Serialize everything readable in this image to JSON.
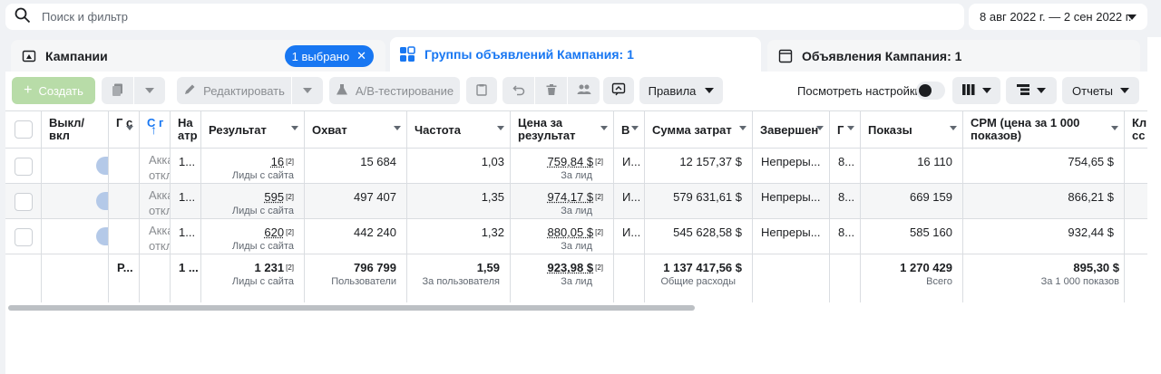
{
  "search": {
    "placeholder": "Поиск и фильтр",
    "icon": "search-icon"
  },
  "date_range": {
    "label": "8 авг 2022 г. — 2 сен 2022 г."
  },
  "tabs": {
    "campaigns": {
      "label": "Кампании",
      "selected": "1 выбрано"
    },
    "adsets": {
      "label": "Группы объявлений Кампания: 1"
    },
    "ads": {
      "label": "Объявления Кампания: 1"
    }
  },
  "toolbar": {
    "create": "Создать",
    "edit": "Редактировать",
    "ab_test": "A/B-тестирование",
    "rules": "Правила",
    "view_settings": "Посмотреть настройки",
    "reports": "Отчеты"
  },
  "columns": {
    "onoff": "Выкл/ вкл",
    "c1": "Г с",
    "c2": "С г",
    "c3": "На атр",
    "result": "Результат",
    "reach": "Охват",
    "frequency": "Частота",
    "cost_per_result": "Цена за результат",
    "c9": "В",
    "amount_spent": "Сумма затрат",
    "ends": "Завершен",
    "c12": "Г",
    "impressions": "Показы",
    "cpm": "CPM (цена за 1 000 показов)",
    "c15": "Кл сс"
  },
  "rows": [
    {
      "status": "Акка откл",
      "attr": "1...",
      "result": "16",
      "result_sub": "Лиды с сайта",
      "reach": "15 684",
      "frequency": "1,03",
      "cpr": "759,84 $",
      "cpr_sub": "За лид",
      "c9": "И...",
      "spent": "12 157,37 $",
      "ends": "Непреры...",
      "c12": "8...",
      "impressions": "16 110",
      "cpm": "754,65 $",
      "note": "[2]"
    },
    {
      "status": "Акка откл",
      "attr": "1...",
      "result": "595",
      "result_sub": "Лиды с сайта",
      "reach": "497 407",
      "frequency": "1,35",
      "cpr": "974,17 $",
      "cpr_sub": "За лид",
      "c9": "И...",
      "spent": "579 631,61 $",
      "ends": "Непреры...",
      "c12": "8...",
      "impressions": "669 159",
      "cpm": "866,21 $",
      "note": "[2]"
    },
    {
      "status": "Акка откл",
      "attr": "1...",
      "result": "620",
      "result_sub": "Лиды с сайта",
      "reach": "442 240",
      "frequency": "1,32",
      "cpr": "880,05 $",
      "cpr_sub": "За лид",
      "c9": "И...",
      "spent": "545 628,58 $",
      "ends": "Непреры...",
      "c12": "8...",
      "impressions": "585 160",
      "cpm": "932,44 $",
      "note": "[2]"
    }
  ],
  "totals": {
    "c1": "Р...",
    "attr": "1 ...",
    "result": "1 231",
    "result_sub": "Лиды с сайта",
    "reach": "796 799",
    "reach_sub": "Пользователи",
    "frequency": "1,59",
    "frequency_sub": "За пользователя",
    "cpr": "923,98 $",
    "cpr_sub": "За лид",
    "spent": "1 137 417,56 $",
    "spent_sub": "Общие расходы",
    "impressions": "1 270 429",
    "impressions_sub": "Всего",
    "cpm": "895,30 $",
    "cpm_sub": "За 1 000 показов",
    "note": "[2]"
  },
  "colors": {
    "accent": "#1877f2",
    "create_btn": "#b8dca8"
  }
}
